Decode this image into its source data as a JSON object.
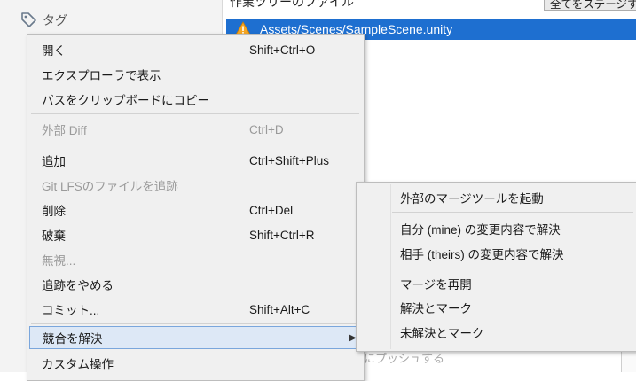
{
  "left_panel": {
    "tag_label": "タグ"
  },
  "right_panel": {
    "file_section_header": "作業ツリーのファイル",
    "stage_all_button": "全てをステージする",
    "selected_file": "Assets/Scenes/SampleScene.unity",
    "bottom_hint": "にプッシュする"
  },
  "context_menu": {
    "open": {
      "label": "開く",
      "shortcut": "Shift+Ctrl+O"
    },
    "show_in_explorer": {
      "label": "エクスプローラで表示"
    },
    "copy_path": {
      "label": "パスをクリップボードにコピー"
    },
    "external_diff": {
      "label": "外部 Diff",
      "shortcut": "Ctrl+D"
    },
    "add": {
      "label": "追加",
      "shortcut": "Ctrl+Shift+Plus"
    },
    "git_lfs_track": {
      "label": "Git LFSのファイルを追跡"
    },
    "remove": {
      "label": "削除",
      "shortcut": "Ctrl+Del"
    },
    "discard": {
      "label": "破棄",
      "shortcut": "Shift+Ctrl+R"
    },
    "ignore": {
      "label": "無視..."
    },
    "untrack": {
      "label": "追跡をやめる"
    },
    "commit": {
      "label": "コミット...",
      "shortcut": "Shift+Alt+C"
    },
    "resolve_conflicts": {
      "label": "競合を解決"
    },
    "custom_actions": {
      "label": "カスタム操作"
    }
  },
  "submenu": {
    "launch_merge_tool": "外部のマージツールを起動",
    "resolve_mine": "自分 (mine) の変更内容で解決",
    "resolve_theirs": "相手 (theirs) の変更内容で解決",
    "restart_merge": "マージを再開",
    "mark_resolved": "解決とマーク",
    "mark_unresolved": "未解決とマーク"
  }
}
